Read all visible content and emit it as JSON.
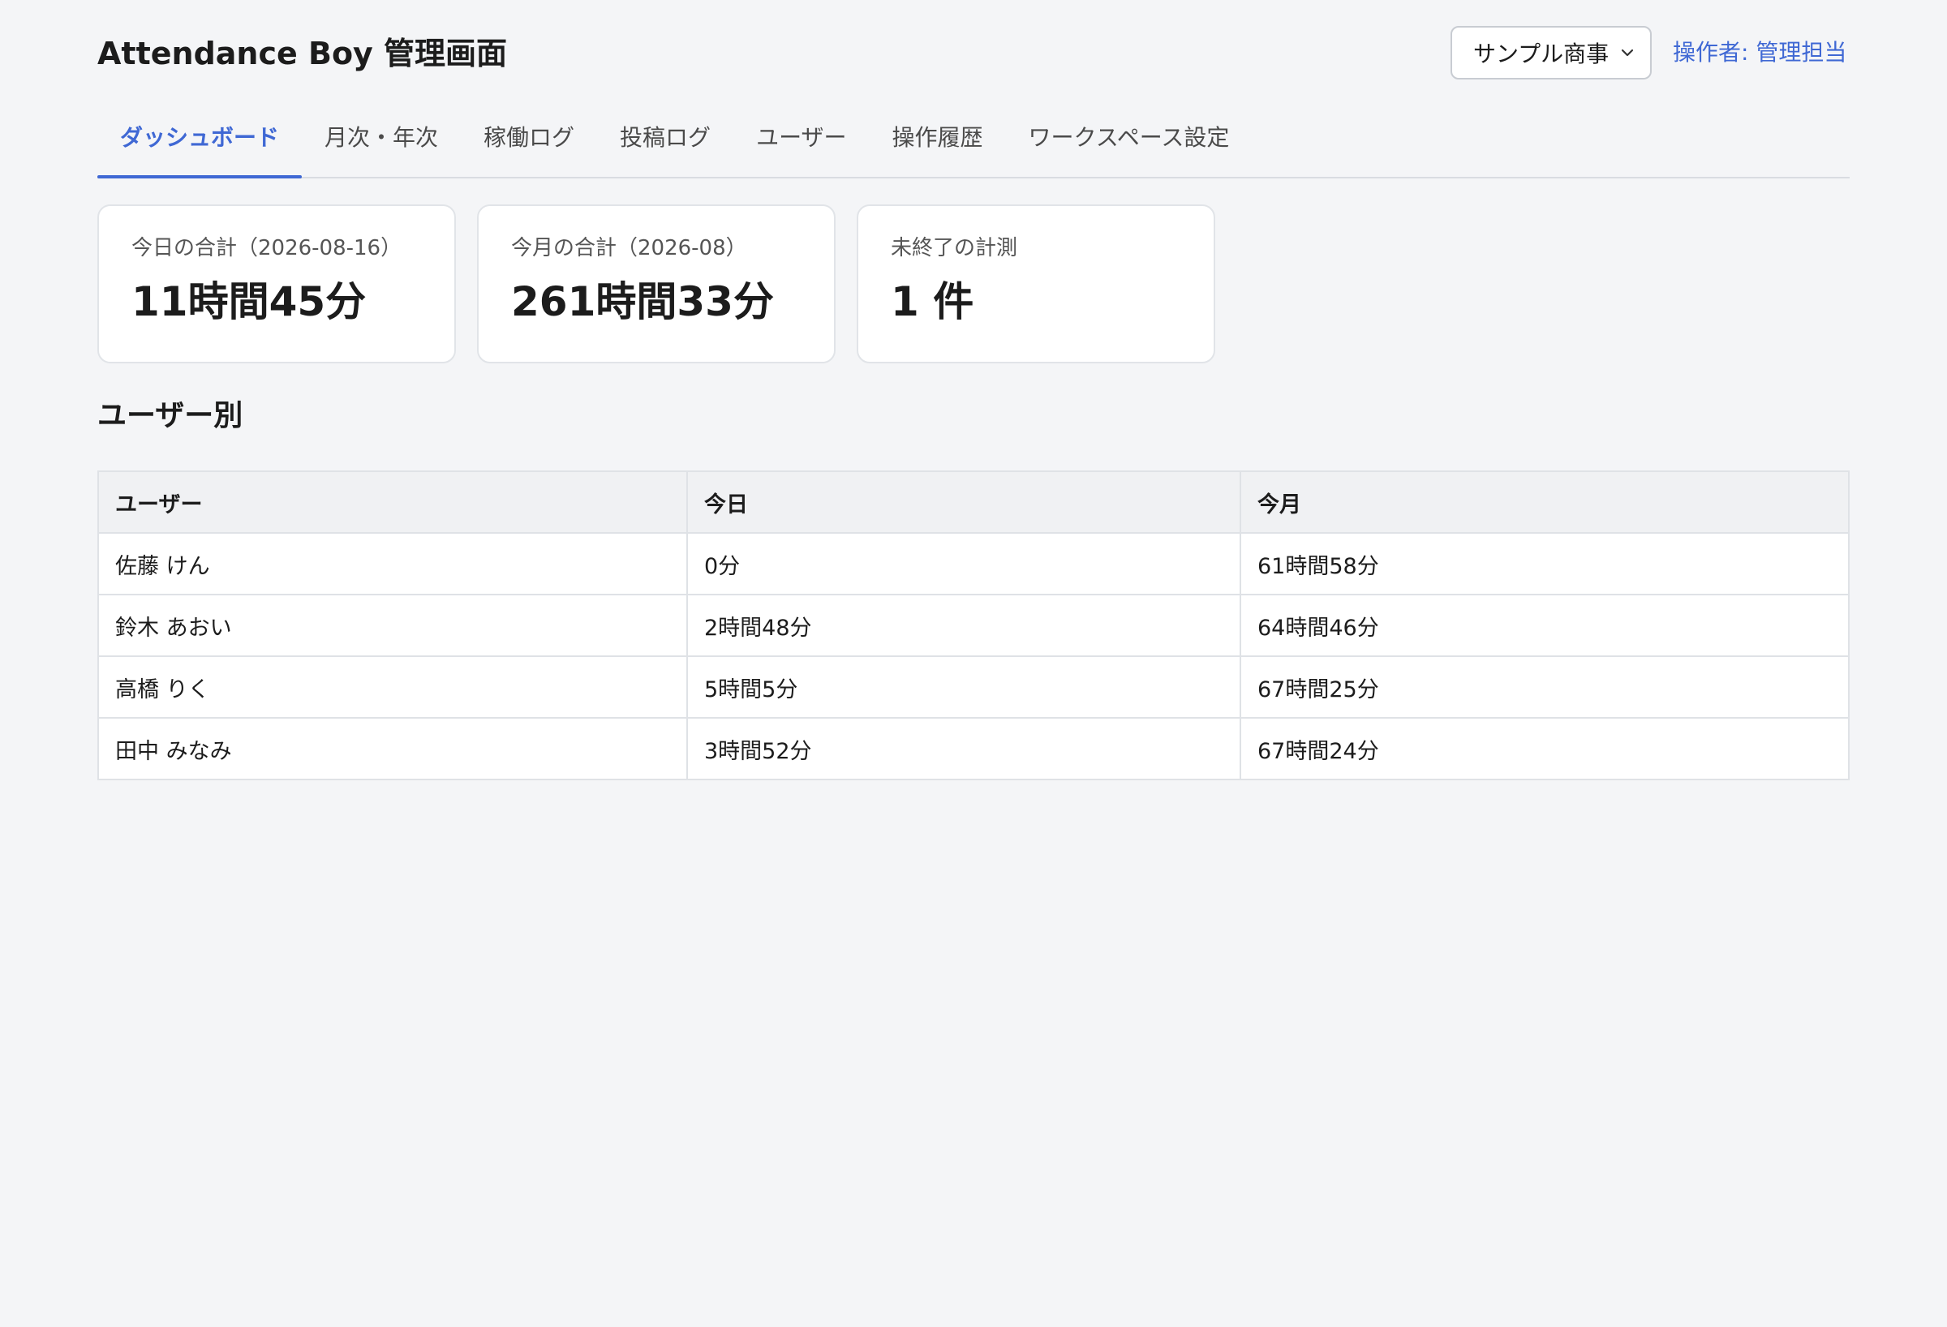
{
  "header": {
    "title": "Attendance Boy 管理画面",
    "workspace_select": {
      "selected": "サンプル商事"
    },
    "operator_link": "操作者: 管理担当"
  },
  "tabs": [
    {
      "label": "ダッシュボード",
      "active": true
    },
    {
      "label": "月次・年次",
      "active": false
    },
    {
      "label": "稼働ログ",
      "active": false
    },
    {
      "label": "投稿ログ",
      "active": false
    },
    {
      "label": "ユーザー",
      "active": false
    },
    {
      "label": "操作履歴",
      "active": false
    },
    {
      "label": "ワークスペース設定",
      "active": false
    }
  ],
  "stats": [
    {
      "label": "今日の合計（2026-08-16）",
      "value": "11時間45分"
    },
    {
      "label": "今月の合計（2026-08）",
      "value": "261時間33分"
    },
    {
      "label": "未終了の計測",
      "value": "1 件"
    }
  ],
  "section": {
    "title": "ユーザー別"
  },
  "table": {
    "headers": [
      "ユーザー",
      "今日",
      "今月"
    ],
    "rows": [
      [
        "佐藤 けん",
        "0分",
        "61時間58分"
      ],
      [
        "鈴木 あおい",
        "2時間48分",
        "64時間46分"
      ],
      [
        "高橋 りく",
        "5時間5分",
        "67時間25分"
      ],
      [
        "田中 みなみ",
        "3時間52分",
        "67時間24分"
      ]
    ]
  },
  "colors": {
    "accent": "#3f68d4",
    "background": "#f4f5f7",
    "card": "#ffffff",
    "border": "#dfe2e6"
  },
  "icons": {
    "select_chevron": "chevron-down-icon"
  }
}
